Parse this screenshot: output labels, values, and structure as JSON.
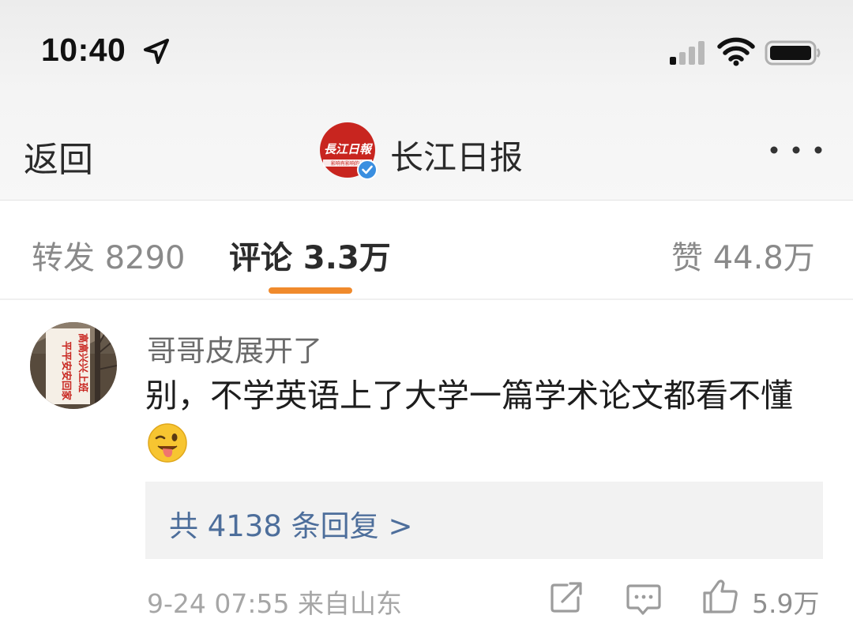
{
  "status_bar": {
    "time": "10:40",
    "icons": [
      "location-arrow-icon",
      "cellular-signal-icon",
      "wifi-icon",
      "battery-icon"
    ]
  },
  "nav": {
    "back_label": "返回",
    "account_name": "长江日报",
    "avatar_logo_text": "長江日報",
    "avatar_tagline": "影响有影响的人",
    "verified": true,
    "more_icon": "more-dots-icon"
  },
  "tabs": {
    "repost": "转发 8290",
    "comments": "评论 3.3万",
    "likes": "赞 44.8万",
    "active": "comments"
  },
  "comment": {
    "author": "哥哥皮展开了",
    "avatar_sign_left": "平平安安回家",
    "avatar_sign_right": "高高兴兴上班",
    "text": "别，不学英语上了大学一篇学术论文都看不懂",
    "emoji": "tongue-wink-emoji-icon",
    "replies_link": "共 4138 条回复 >",
    "meta": "9-24  07:55  来自山东",
    "like_count": "5.9万"
  },
  "colors": {
    "tab_indicator": "#f08a2c",
    "link": "#4d6e9b",
    "avatar_red": "#c8251f",
    "verified_blue": "#3a8fe0"
  }
}
